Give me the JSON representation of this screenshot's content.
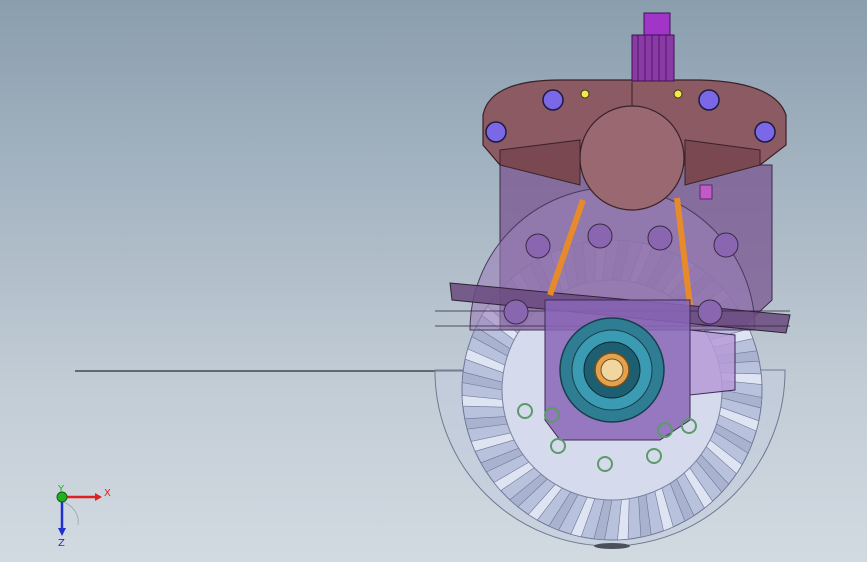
{
  "viewport": {
    "background_top": "#8a9eae",
    "background_bottom": "#d2dae1"
  },
  "model": {
    "colors": {
      "housing_top": "#8b5a63",
      "housing_purple": "#7a5690",
      "bolt": "#7a68e6",
      "bolt_hole_yellow": "#f4e84a",
      "spline_shaft": "#a035c8",
      "ring_gear": "#c8d0e6",
      "differential_case": "#8a66b8",
      "bearing_teal": "#2e7d93",
      "bearing_inner": "#e3a24e",
      "transparent_shell": "#c2ccde",
      "strut_orange": "#e68a2c",
      "o_ring_green": "#5c9a6a"
    }
  },
  "triad": {
    "x_label": "X",
    "y_label": "Y",
    "z_label": "Z",
    "x_color": "#e02020",
    "y_color": "#20b020",
    "z_color": "#2030d0"
  }
}
